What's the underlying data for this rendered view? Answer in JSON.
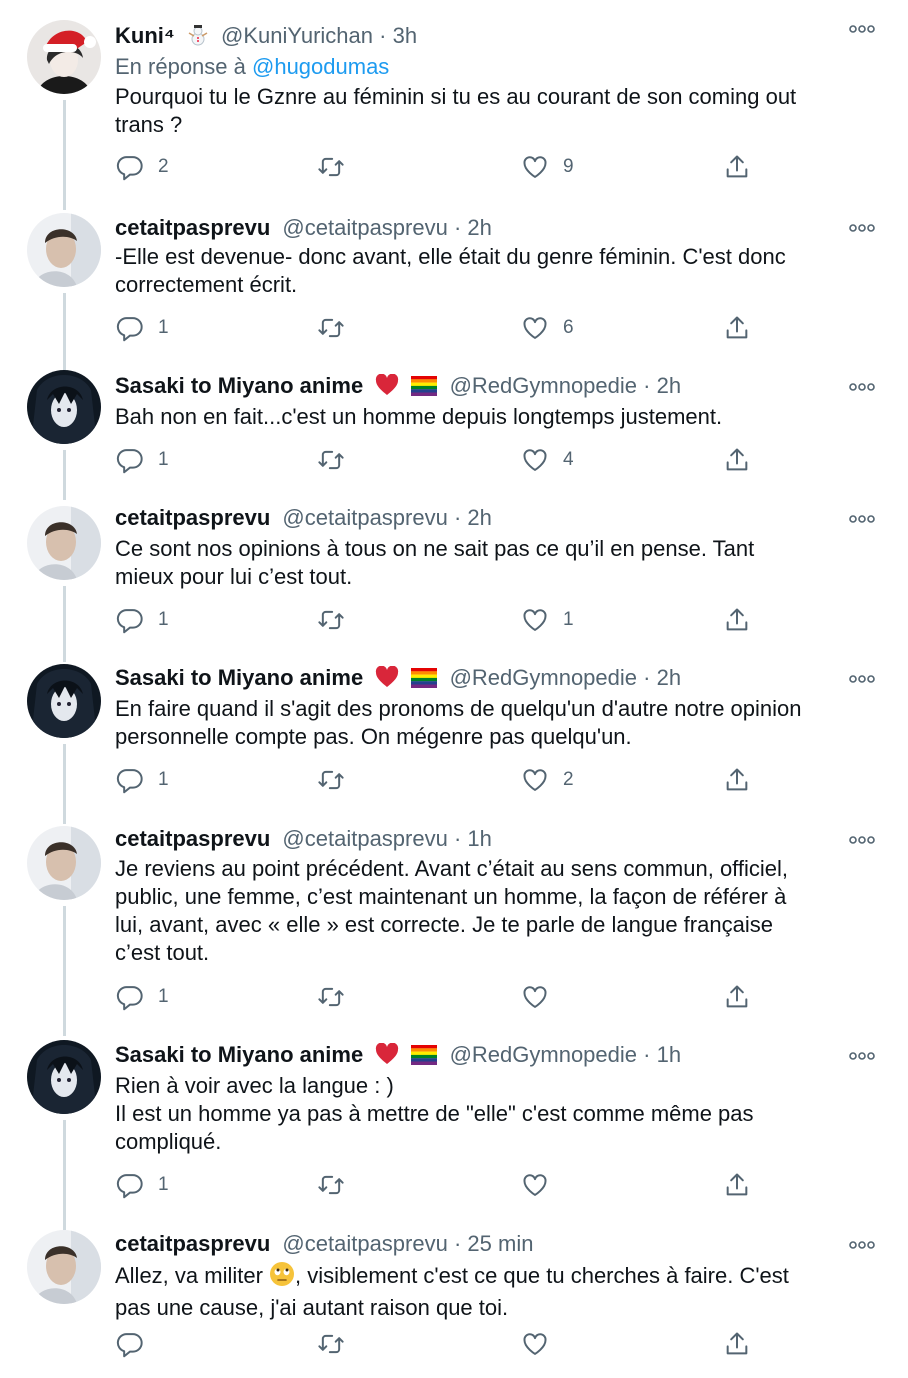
{
  "tweets": [
    {
      "name": "Kuni⁴",
      "handle": "@KuniYurichan",
      "time": "3h",
      "reply_prefix": "En réponse à",
      "reply_mention": "@hugodumas",
      "lines": [
        "Pourquoi tu le Gznre au féminin si tu es au courant de son coming out",
        "trans ?"
      ],
      "replies": "2",
      "retweets": "",
      "likes": "9",
      "avatar": "avatar-kuni"
    },
    {
      "name": "cetaitpasprevu",
      "handle": "@cetaitpasprevu",
      "time": "2h",
      "lines": [
        "-Elle est devenue- donc avant, elle était du genre féminin. C'est donc",
        "correctement écrit."
      ],
      "replies": "1",
      "retweets": "",
      "likes": "6",
      "avatar": "avatar-cetait"
    },
    {
      "name": "Sasaki to Miyano anime",
      "handle": "@RedGymnopedie",
      "time": "2h",
      "lines": [
        "Bah non en fait...c'est un homme depuis longtemps justement."
      ],
      "replies": "1",
      "retweets": "",
      "likes": "4",
      "avatar": "avatar-sasaki"
    },
    {
      "name": "cetaitpasprevu",
      "handle": "@cetaitpasprevu",
      "time": "2h",
      "lines": [
        "Ce sont nos opinions à tous on ne sait pas ce qu’il en pense. Tant",
        "mieux pour lui c’est tout."
      ],
      "replies": "1",
      "retweets": "",
      "likes": "1",
      "avatar": "avatar-cetait"
    },
    {
      "name": "Sasaki to Miyano anime",
      "handle": "@RedGymnopedie",
      "time": "2h",
      "lines": [
        "En faire quand il s'agit des pronoms de quelqu'un d'autre notre opinion",
        "personnelle compte pas. On mégenre pas quelqu'un."
      ],
      "replies": "1",
      "retweets": "",
      "likes": "2",
      "avatar": "avatar-sasaki"
    },
    {
      "name": "cetaitpasprevu",
      "handle": "@cetaitpasprevu",
      "time": "1h",
      "lines": [
        "Je reviens au point précédent. Avant c’était au sens commun, officiel,",
        "public, une femme, c’est maintenant un homme, la façon de référer à",
        "lui, avant, avec « elle » est correcte. Je te parle de langue française",
        "c’est tout."
      ],
      "replies": "1",
      "retweets": "",
      "likes": "",
      "avatar": "avatar-cetait"
    },
    {
      "name": "Sasaki to Miyano anime",
      "handle": "@RedGymnopedie",
      "time": "1h",
      "lines": [
        "Rien à voir avec la langue : )",
        "Il est un homme ya pas à mettre de \"elle\" c'est comme même pas",
        "compliqué."
      ],
      "replies": "1",
      "retweets": "",
      "likes": "",
      "avatar": "avatar-sasaki"
    },
    {
      "name": "cetaitpasprevu",
      "handle": "@cetaitpasprevu",
      "time": "25 min",
      "lines": [
        "Allez, va militer",
        ", visiblement c'est ce que tu cherches à faire. C'est",
        "pas une cause, j'ai autant raison que toi."
      ],
      "replies": "",
      "retweets": "",
      "likes": "",
      "avatar": "avatar-cetait"
    }
  ],
  "separator": "·",
  "colors": {
    "text": "#0f1419",
    "muted": "#536471",
    "link": "#1d9bf0",
    "thread_line": "#cfd9de",
    "heart": "#d9263a"
  },
  "icons": {
    "reply": "reply-icon",
    "retweet": "retweet-icon",
    "like": "heart-icon",
    "share": "share-icon",
    "more": "more-icon"
  }
}
